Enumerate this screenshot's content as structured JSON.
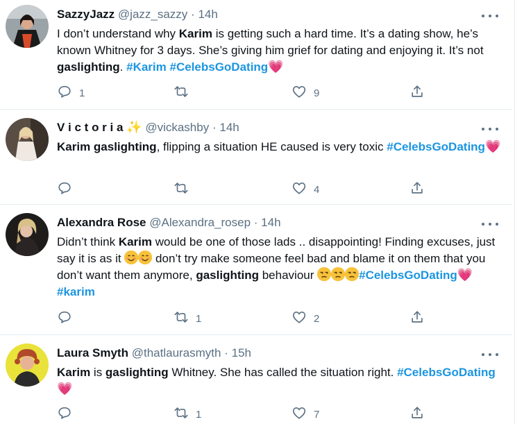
{
  "tweets": [
    {
      "name": "SazzyJazz",
      "handle": "@jazz_sazzy",
      "sep": "·",
      "time": "14h",
      "text_runs": [
        {
          "t": "I don’t understand why ",
          "s": "plain"
        },
        {
          "t": "Karim",
          "s": "bold"
        },
        {
          "t": " is getting such a hard time. It’s a dating show, he’s known Whitney for 3 days. She’s giving him grief for dating and enjoying it. It’s not ",
          "s": "plain"
        },
        {
          "t": "gaslighting",
          "s": "bold"
        },
        {
          "t": ". ",
          "s": "plain"
        },
        {
          "t": "#Karim",
          "s": "tag"
        },
        {
          "t": " ",
          "s": "plain"
        },
        {
          "t": " #CelebsGoDating",
          "s": "tag"
        },
        {
          "t": "💗",
          "s": "heart"
        }
      ],
      "replies": "1",
      "retweets": "",
      "likes": "9"
    },
    {
      "name": "V i c t o r i a",
      "badge": "✨",
      "handle": "@vickashby",
      "sep": "·",
      "time": "14h",
      "text_runs": [
        {
          "t": "Karim gaslighting",
          "s": "bold"
        },
        {
          "t": ", flipping a situation HE caused is very toxic ",
          "s": "plain"
        },
        {
          "t": "#CelebsGoDating",
          "s": "tag"
        },
        {
          "t": "💗",
          "s": "heart"
        }
      ],
      "replies": "",
      "retweets": "",
      "likes": "4"
    },
    {
      "name": "Alexandra Rose",
      "handle": "@Alexandra_rosep",
      "sep": "·",
      "time": "14h",
      "text_runs": [
        {
          "t": "Didn’t think ",
          "s": "plain"
        },
        {
          "t": "Karim",
          "s": "bold"
        },
        {
          "t": " would be one of those lads .. disappointing! Finding excuses, just say it is as it ",
          "s": "plain"
        },
        {
          "t": "smiling-face",
          "s": "happy"
        },
        {
          "t": "smiling-face",
          "s": "happy"
        },
        {
          "t": " don’t try make someone feel bad and blame it on them that you don’t want them anymore, ",
          "s": "plain"
        },
        {
          "t": "gaslighting",
          "s": "bold"
        },
        {
          "t": " behaviour ",
          "s": "plain"
        },
        {
          "t": "unamused-face",
          "s": "unamused"
        },
        {
          "t": "unamused-face",
          "s": "unamused"
        },
        {
          "t": "unamused-face",
          "s": "unamused"
        },
        {
          "t": "#CelebsGoDating",
          "s": "tag"
        },
        {
          "t": "💗",
          "s": "heart"
        },
        {
          "t": " ",
          "s": "plain"
        },
        {
          "t": "#karim",
          "s": "tag"
        }
      ],
      "replies": "",
      "retweets": "1",
      "likes": "2"
    },
    {
      "name": "Laura Smyth",
      "handle": "@thatlaurasmyth",
      "sep": "·",
      "time": "15h",
      "text_runs": [
        {
          "t": "Karim",
          "s": "bold"
        },
        {
          "t": " is ",
          "s": "plain"
        },
        {
          "t": "gaslighting",
          "s": "bold"
        },
        {
          "t": " Whitney. She has called the situation right. ",
          "s": "plain"
        },
        {
          "t": "#CelebsGoDating",
          "s": "tag"
        },
        {
          "t": "💗",
          "s": "heart"
        }
      ],
      "replies": "",
      "retweets": "1",
      "likes": "7"
    }
  ],
  "icons": {
    "reply": "reply-icon",
    "retweet": "retweet-icon",
    "like": "like-icon",
    "share": "share-icon",
    "more": "more-icon"
  },
  "colors": {
    "hashtag": "#1b95e0",
    "secondary_text": "#5b7083",
    "icon": "#5b7083",
    "divider": "#e6ecf0"
  }
}
